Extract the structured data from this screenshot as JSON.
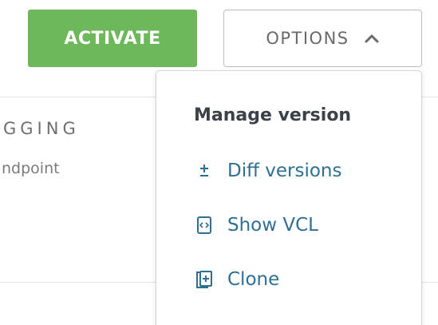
{
  "toolbar": {
    "activate_label": "ACTIVATE",
    "options_label": "OPTIONS"
  },
  "background": {
    "section_heading": "GGING",
    "section_sub": "ndpoint"
  },
  "menu": {
    "title": "Manage version",
    "items": [
      {
        "label": "Diff versions",
        "icon": "plus-minus-icon"
      },
      {
        "label": "Show VCL",
        "icon": "code-file-icon"
      },
      {
        "label": "Clone",
        "icon": "clone-icon"
      }
    ]
  },
  "colors": {
    "activate_bg": "#6db85a",
    "link": "#2f6f93",
    "heading": "#3b4148"
  }
}
